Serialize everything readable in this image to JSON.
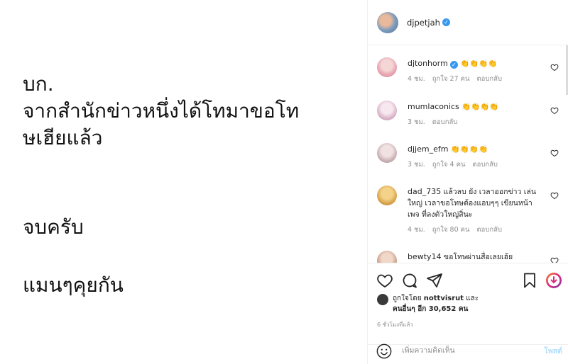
{
  "post": {
    "text1": "บก.\nจากสำนักข่าวหนึ่งได้โทมาขอโท\nษเฮียแล้ว",
    "text2": "จบครับ",
    "text3": "แมนๆคุยกัน"
  },
  "header": {
    "username": "djpetjah",
    "verified": "✓"
  },
  "comments": [
    {
      "username": "djtonhorm",
      "text": "👏👏👏👏",
      "time": "4 ชม.",
      "likes": "ถูกใจ 27 คน",
      "reply": "ตอบกลับ"
    },
    {
      "username": "mumlaconics",
      "text": "👏👏👏👏",
      "time": "3 ชม.",
      "likes": "",
      "reply": "ตอบกลับ"
    },
    {
      "username": "djjem_efm",
      "text": "👏👏👏👏",
      "time": "3 ชม.",
      "likes": "ถูกใจ 4 คน",
      "reply": "ตอบกลับ"
    },
    {
      "username": "dad_735",
      "text": "แล้วลบ ยัง เวลาออกข่าว เล่นใหญ่ เวลาขอโทษต้องแอบๆๆ เขียนหน้าเพจ ที่ลงตัวใหญ่สิ่นะ",
      "time": "4 ชม.",
      "likes": "ถูกใจ 80 คน",
      "reply": "ตอบกลับ"
    },
    {
      "username": "bewty14",
      "text": "ขอโทษผ่านสื่อเลยเฮ้ย",
      "time": "",
      "likes": "",
      "reply": ""
    }
  ],
  "likes": {
    "prefix": "ถูกใจโดย ",
    "user": "nottvisrut",
    "mid": " และ",
    "others": "คนอื่นๆ อีก 30,652 คน"
  },
  "time_ago": "6 ชั่วโมงที่แล้ว",
  "add_comment": {
    "placeholder": "เพิ่มความคิดเห็น",
    "post_label": "โพสต์"
  },
  "colors": {
    "verified": "#3897f0",
    "post_button": "#b2dffc",
    "muted": "#8e8e8e"
  }
}
